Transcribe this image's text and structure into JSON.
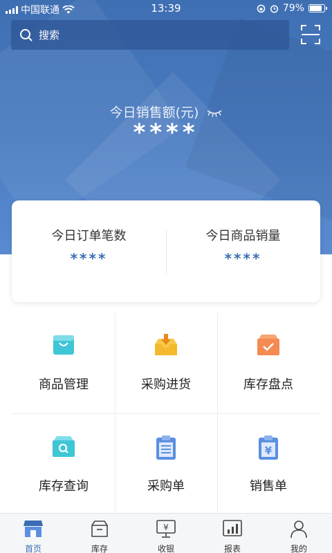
{
  "status_bar": {
    "carrier": "中国联通",
    "time": "13:39",
    "battery": "79%",
    "battery_level": 0.79
  },
  "search": {
    "placeholder": "搜索"
  },
  "sales": {
    "label": "今日销售额(元)",
    "value": "****"
  },
  "stats": [
    {
      "label": "今日订单笔数",
      "value": "****"
    },
    {
      "label": "今日商品销量",
      "value": "****"
    }
  ],
  "grid": [
    {
      "label": "商品管理",
      "icon": "shopping-bag-icon",
      "color": "#3fc6d6"
    },
    {
      "label": "采购进货",
      "icon": "inbox-download-icon",
      "color": "#f5b92d"
    },
    {
      "label": "库存盘点",
      "icon": "box-check-icon",
      "color": "#f58a52"
    },
    {
      "label": "库存查询",
      "icon": "box-search-icon",
      "color": "#3fc6d6"
    },
    {
      "label": "采购单",
      "icon": "clipboard-list-icon",
      "color": "#5b8fe0"
    },
    {
      "label": "销售单",
      "icon": "clipboard-yen-icon",
      "color": "#5b8fe0"
    }
  ],
  "tabs": [
    {
      "label": "首页",
      "icon": "store-icon",
      "active": true
    },
    {
      "label": "库存",
      "icon": "box-icon",
      "active": false
    },
    {
      "label": "收银",
      "icon": "cashier-monitor-icon",
      "active": false
    },
    {
      "label": "报表",
      "icon": "bar-chart-icon",
      "active": false
    },
    {
      "label": "我的",
      "icon": "user-icon",
      "active": false
    }
  ],
  "colors": {
    "header_blue": "#4a7cc1",
    "accent": "#3a6db4"
  }
}
